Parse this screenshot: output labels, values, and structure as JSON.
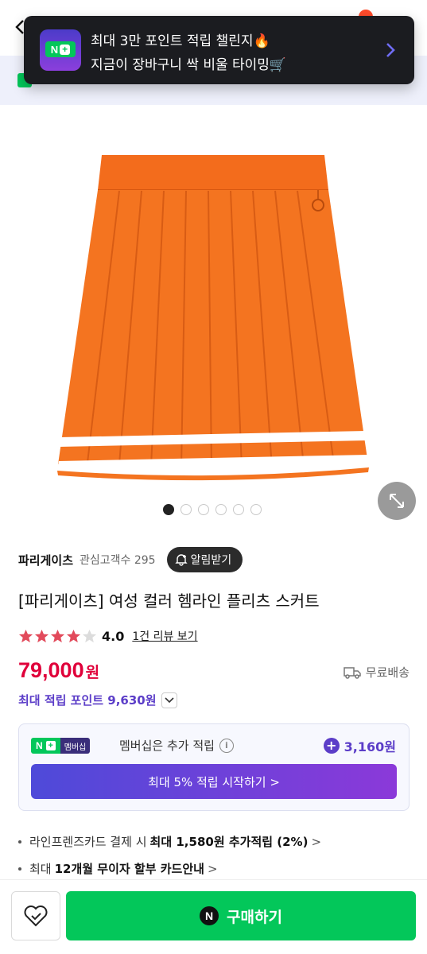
{
  "toast": {
    "line1": "최대 3만 포인트 적립 챌린지🔥",
    "line2": "지금이 장바구니 싹 비울 타이밍🛒",
    "badge_text": "N",
    "badge_icon": "naver-plus-icon",
    "chevron_icon": "chevron-right-icon"
  },
  "gallery": {
    "image_alt": "orange pleated skirt with white hem stripes",
    "total_images": 6,
    "current_index": 1,
    "zoom_icon": "expand-icon"
  },
  "store": {
    "name": "파리게이츠",
    "fans": "관심고객수 295",
    "alarm_label": "알림받기",
    "alarm_icon": "bell-plus-icon"
  },
  "product": {
    "title": "[파리게이츠] 여성 컬러 헴라인 플리츠 스커트",
    "rating": 4.0,
    "rating_text": "4.0",
    "reviews_link": "1건 리뷰 보기",
    "price": "79,000",
    "price_unit": "원",
    "shipping": "무료배송",
    "points": "최대 적립 포인트 9,630원"
  },
  "membership": {
    "tag_left": "N",
    "tag_right": "멤버십",
    "desc": "멤버십은 추가 적립",
    "info_icon": "i",
    "amount": "3,160원",
    "cta": "최대 5% 적립 시작하기 >"
  },
  "benefits": {
    "line1_prefix": "라인프렌즈카드 결제 시",
    "line1_bold": "최대 1,580원 추가적립 (2%)",
    "line2_prefix": "최대",
    "line2_bold": "12개월 무이자 할부 카드안내",
    "arrow": ">"
  },
  "bottom": {
    "buy_label": "구매하기",
    "buy_logo": "N"
  },
  "colors": {
    "accent_purple": "#5b3dc8",
    "price_red": "#e0003a",
    "naver_green": "#03c75a",
    "skirt_orange": "#f36c1c"
  }
}
